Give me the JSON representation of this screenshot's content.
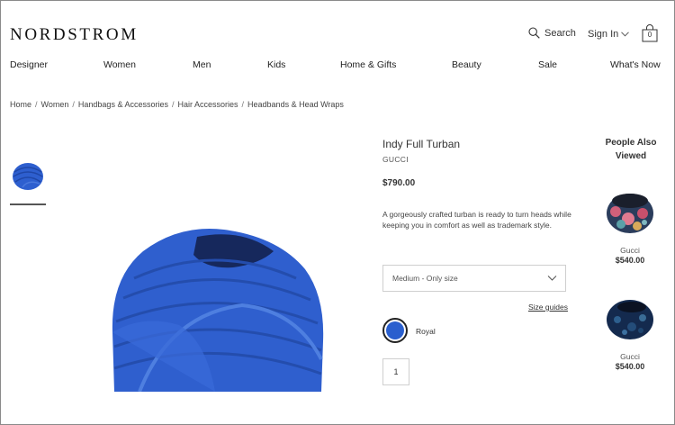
{
  "header": {
    "logo": "NORDSTROM",
    "search_label": "Search",
    "signin_label": "Sign In",
    "bag_count": "0"
  },
  "nav": {
    "items": [
      "Designer",
      "Women",
      "Men",
      "Kids",
      "Home & Gifts",
      "Beauty",
      "Sale",
      "What's Now"
    ]
  },
  "breadcrumb": [
    "Home",
    "Women",
    "Handbags & Accessories",
    "Hair Accessories",
    "Headbands & Head Wraps"
  ],
  "product": {
    "name": "Indy Full Turban",
    "brand": "GUCCI",
    "price": "$790.00",
    "description": "A gorgeously crafted turban is ready to turn heads while keeping you in comfort as well as trademark style.",
    "size_selected": "Medium - Only size",
    "size_guides_label": "Size guides",
    "color_name": "Royal",
    "color_hex": "#2a5fce",
    "quantity": "1"
  },
  "people_also_viewed": {
    "title": "People Also Viewed",
    "items": [
      {
        "brand": "Gucci",
        "price": "$540.00"
      },
      {
        "brand": "Gucci",
        "price": "$540.00"
      }
    ]
  }
}
